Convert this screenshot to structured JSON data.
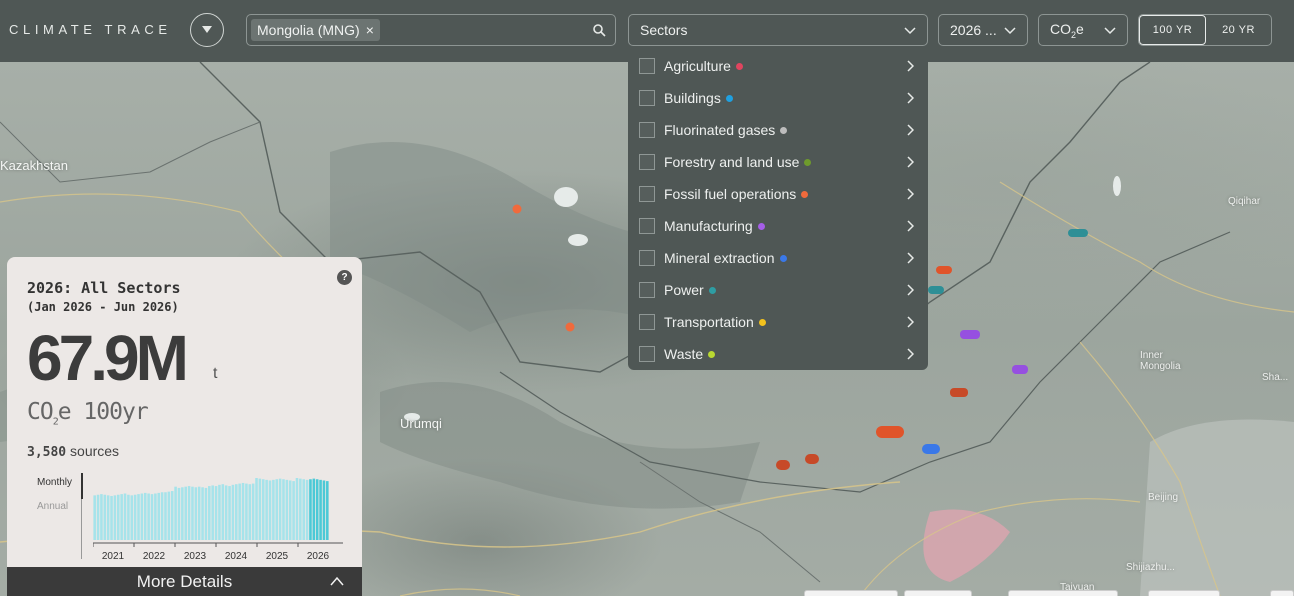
{
  "header": {
    "logo": "CLIMATE TRACE",
    "search": {
      "chip": "Mongolia (MNG)",
      "chip_remove": "×"
    },
    "sectors_select": "Sectors",
    "year_select": "2026 ...",
    "gas_select": {
      "main": "CO",
      "sub": "2",
      "tail": "e"
    },
    "gwp": [
      "100 YR",
      "20 YR"
    ],
    "gwp_active": "100 YR"
  },
  "sectors_menu": {
    "items": [
      {
        "label": "Agriculture",
        "color": "#e0455f"
      },
      {
        "label": "Buildings",
        "color": "#1fa0e0"
      },
      {
        "label": "Fluorinated gases",
        "color": "#bdbdbd"
      },
      {
        "label": "Forestry and land use",
        "color": "#6e9b2c"
      },
      {
        "label": "Fossil fuel operations",
        "color": "#f06a3c"
      },
      {
        "label": "Manufacturing",
        "color": "#a55ee8"
      },
      {
        "label": "Mineral extraction",
        "color": "#3a78e8"
      },
      {
        "label": "Power",
        "color": "#2e9da3"
      },
      {
        "label": "Transportation",
        "color": "#f3c21d"
      },
      {
        "label": "Waste",
        "color": "#b9d831"
      }
    ]
  },
  "map": {
    "labels": {
      "kazakhstan": "Kazakhstan",
      "urumqi": "Urumqi",
      "qiqihar": "Qiqihar",
      "inner_mongolia": "Inner Mongolia",
      "beijing": "Beijing",
      "shijiazhuang": "Shijiazhu...",
      "taiyuan": "Taiyuan",
      "sha": "Sha..."
    }
  },
  "panel": {
    "title": "2026: All Sectors",
    "range": "(Jan 2026 - Jun 2026)",
    "total": "67.9M",
    "unit": "t",
    "gas": {
      "main": "CO",
      "sub": "2",
      "tail": "e 100yr"
    },
    "sources_count": "3,580",
    "sources_label": "sources",
    "periods": [
      "Monthly",
      "Annual"
    ],
    "active_period": "Monthly",
    "more_details": "More Details",
    "help": "?"
  },
  "chart_data": {
    "type": "bar",
    "title": "",
    "x_ticks": [
      "2021",
      "2022",
      "2023",
      "2024",
      "2025",
      "2026"
    ],
    "monthly_values_relative": [
      0.72,
      0.73,
      0.74,
      0.73,
      0.72,
      0.71,
      0.72,
      0.73,
      0.74,
      0.75,
      0.73,
      0.72,
      0.73,
      0.74,
      0.75,
      0.76,
      0.75,
      0.74,
      0.75,
      0.76,
      0.77,
      0.77,
      0.78,
      0.79,
      0.86,
      0.84,
      0.85,
      0.86,
      0.87,
      0.86,
      0.85,
      0.86,
      0.85,
      0.84,
      0.87,
      0.88,
      0.87,
      0.89,
      0.9,
      0.88,
      0.87,
      0.89,
      0.9,
      0.91,
      0.92,
      0.91,
      0.9,
      0.91,
      1.0,
      0.99,
      0.98,
      0.97,
      0.96,
      0.97,
      0.98,
      0.99,
      0.98,
      0.97,
      0.96,
      0.95,
      1.0,
      0.99,
      0.98,
      0.97,
      0.98,
      0.99,
      0.98,
      0.97,
      0.96,
      0.95
    ],
    "highlight_last_n": 6,
    "colors": {
      "past": "#a6e3ea",
      "current": "#4cc9d6"
    }
  }
}
